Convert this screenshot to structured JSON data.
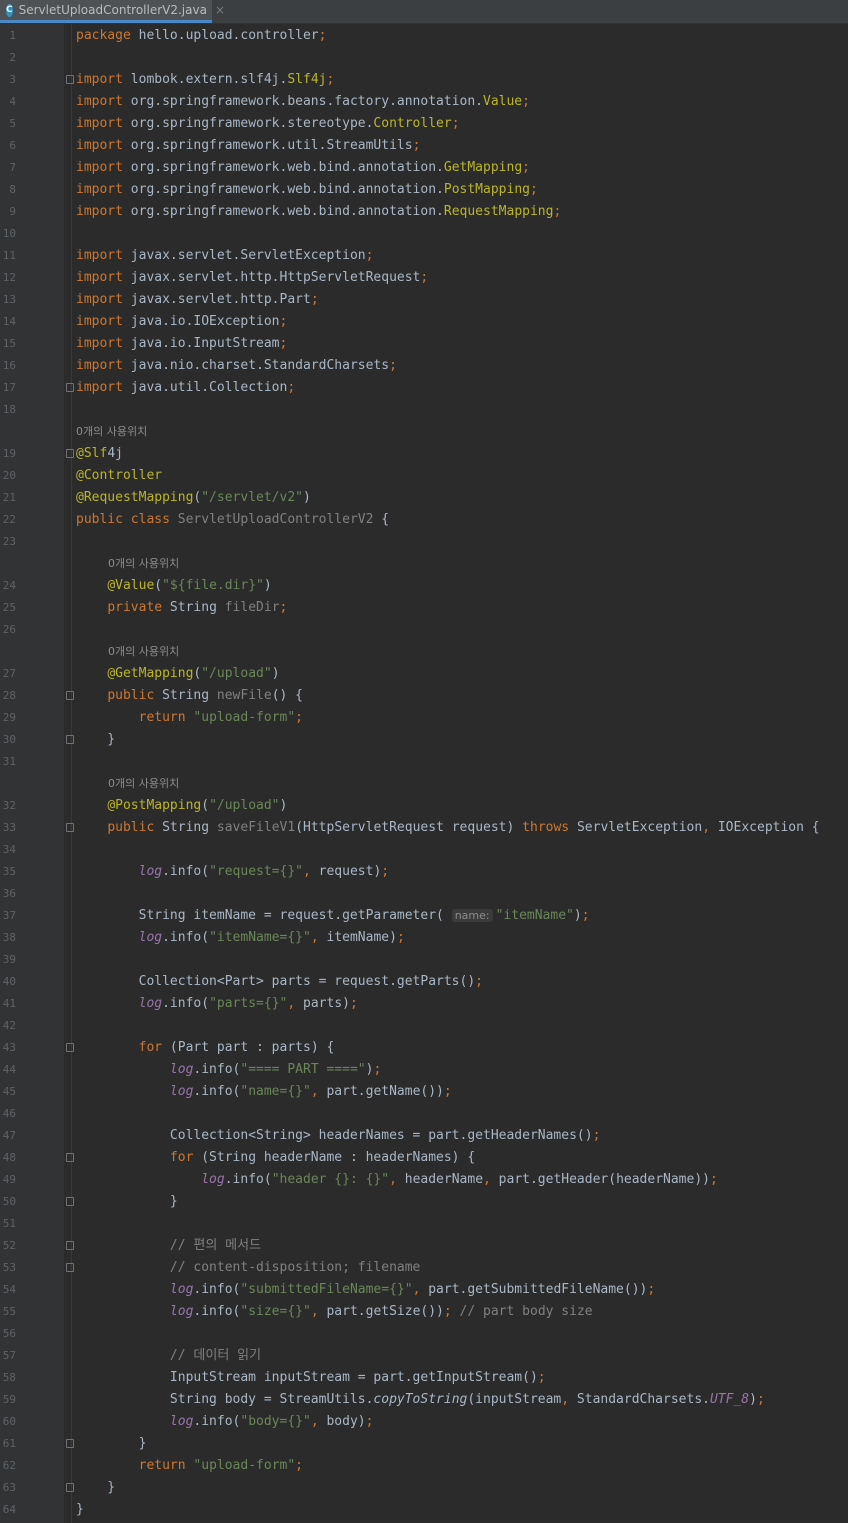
{
  "tab": {
    "title": "ServletUploadControllerV2.java",
    "icon_letter": "C",
    "close_glyph": "×"
  },
  "usage_hint": "0개의 사용위치",
  "param_hint": "name:",
  "lines": [
    {
      "n": "1",
      "t": "package hello.upload.controller;"
    },
    {
      "n": "2",
      "t": ""
    },
    {
      "n": "3",
      "t": "import lombok.extern.slf4j.Slf4j;"
    },
    {
      "n": "4",
      "t": "import org.springframework.beans.factory.annotation.Value;"
    },
    {
      "n": "5",
      "t": "import org.springframework.stereotype.Controller;"
    },
    {
      "n": "6",
      "t": "import org.springframework.util.StreamUtils;"
    },
    {
      "n": "7",
      "t": "import org.springframework.web.bind.annotation.GetMapping;"
    },
    {
      "n": "8",
      "t": "import org.springframework.web.bind.annotation.PostMapping;"
    },
    {
      "n": "9",
      "t": "import org.springframework.web.bind.annotation.RequestMapping;"
    },
    {
      "n": "10",
      "t": ""
    },
    {
      "n": "11",
      "t": "import javax.servlet.ServletException;"
    },
    {
      "n": "12",
      "t": "import javax.servlet.http.HttpServletRequest;"
    },
    {
      "n": "13",
      "t": "import javax.servlet.http.Part;"
    },
    {
      "n": "14",
      "t": "import java.io.IOException;"
    },
    {
      "n": "15",
      "t": "import java.io.InputStream;"
    },
    {
      "n": "16",
      "t": "import java.nio.charset.StandardCharsets;"
    },
    {
      "n": "17",
      "t": "import java.util.Collection;"
    },
    {
      "n": "18",
      "t": ""
    },
    {
      "n": "19",
      "t": "@Slf4j"
    },
    {
      "n": "20",
      "t": "@Controller"
    },
    {
      "n": "21",
      "t": "@RequestMapping(\"/servlet/v2\")"
    },
    {
      "n": "22",
      "t": "public class ServletUploadControllerV2 {"
    },
    {
      "n": "23",
      "t": ""
    },
    {
      "n": "24",
      "t": "    @Value(\"${file.dir}\")"
    },
    {
      "n": "25",
      "t": "    private String fileDir;"
    },
    {
      "n": "26",
      "t": ""
    },
    {
      "n": "27",
      "t": "    @GetMapping(\"/upload\")"
    },
    {
      "n": "28",
      "t": "    public String newFile() {"
    },
    {
      "n": "29",
      "t": "        return \"upload-form\";"
    },
    {
      "n": "30",
      "t": "    }"
    },
    {
      "n": "31",
      "t": ""
    },
    {
      "n": "32",
      "t": "    @PostMapping(\"/upload\")"
    },
    {
      "n": "33",
      "t": "    public String saveFileV1(HttpServletRequest request) throws ServletException, IOException {"
    },
    {
      "n": "34",
      "t": ""
    },
    {
      "n": "35",
      "t": "        log.info(\"request={}\", request);"
    },
    {
      "n": "36",
      "t": ""
    },
    {
      "n": "37",
      "t": "        String itemName = request.getParameter( name: \"itemName\");"
    },
    {
      "n": "38",
      "t": "        log.info(\"itemName={}\", itemName);"
    },
    {
      "n": "39",
      "t": ""
    },
    {
      "n": "40",
      "t": "        Collection<Part> parts = request.getParts();"
    },
    {
      "n": "41",
      "t": "        log.info(\"parts={}\", parts);"
    },
    {
      "n": "42",
      "t": ""
    },
    {
      "n": "43",
      "t": "        for (Part part : parts) {"
    },
    {
      "n": "44",
      "t": "            log.info(\"==== PART ====\");"
    },
    {
      "n": "45",
      "t": "            log.info(\"name={}\", part.getName());"
    },
    {
      "n": "46",
      "t": ""
    },
    {
      "n": "47",
      "t": "            Collection<String> headerNames = part.getHeaderNames();"
    },
    {
      "n": "48",
      "t": "            for (String headerName : headerNames) {"
    },
    {
      "n": "49",
      "t": "                log.info(\"header {}: {}\", headerName, part.getHeader(headerName));"
    },
    {
      "n": "50",
      "t": "            }"
    },
    {
      "n": "51",
      "t": ""
    },
    {
      "n": "52",
      "t": "            // 편의 메서드"
    },
    {
      "n": "53",
      "t": "            // content-disposition; filename"
    },
    {
      "n": "54",
      "t": "            log.info(\"submittedFileName={}\", part.getSubmittedFileName());"
    },
    {
      "n": "55",
      "t": "            log.info(\"size={}\", part.getSize()); // part body size"
    },
    {
      "n": "56",
      "t": ""
    },
    {
      "n": "57",
      "t": "            // 데이터 읽기"
    },
    {
      "n": "58",
      "t": "            InputStream inputStream = part.getInputStream();"
    },
    {
      "n": "59",
      "t": "            String body = StreamUtils.copyToString(inputStream, StandardCharsets.UTF_8);"
    },
    {
      "n": "60",
      "t": "            log.info(\"body={}\", body);"
    },
    {
      "n": "61",
      "t": "        }"
    },
    {
      "n": "62",
      "t": "        return \"upload-form\";"
    },
    {
      "n": "63",
      "t": "    }"
    },
    {
      "n": "64",
      "t": "}"
    }
  ]
}
